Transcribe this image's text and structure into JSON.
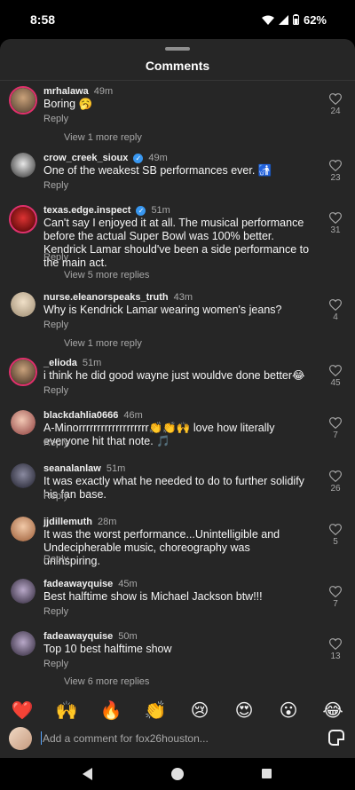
{
  "status": {
    "time": "8:58",
    "battery": "62%"
  },
  "sheet": {
    "title": "Comments"
  },
  "comments": [
    {
      "user": "mrhalawa",
      "time": "49m",
      "verified": false,
      "text": "Boring 🥱",
      "reply": "Reply",
      "likes": "24",
      "view_replies": "View 1 more reply"
    },
    {
      "user": "crow_creek_sioux",
      "time": "49m",
      "verified": true,
      "text": "One of the weakest SB performances ever. 🚮",
      "reply": "Reply",
      "likes": "23",
      "view_replies": ""
    },
    {
      "user": "texas.edge.inspect",
      "time": "51m",
      "verified": true,
      "text": "Can't say I enjoyed it at all. The musical performance before the actual Super Bowl was 100% better. Kendrick Lamar should've been a side performance to the main act.",
      "reply": "Reply",
      "likes": "31",
      "view_replies": "View 5 more replies"
    },
    {
      "user": "nurse.eleanorspeaks_truth",
      "time": "43m",
      "verified": false,
      "text": "Why is Kendrick Lamar wearing women's jeans?",
      "reply": "Reply",
      "likes": "4",
      "view_replies": "View 1 more reply"
    },
    {
      "user": "_elioda",
      "time": "51m",
      "verified": false,
      "text": "i think he did good wayne just wouldve done better😂",
      "reply": "Reply",
      "likes": "45",
      "view_replies": ""
    },
    {
      "user": "blackdahlia0666",
      "time": "46m",
      "verified": false,
      "text": "A-Minorrrrrrrrrrrrrrrrrrr👏👏🙌 love how literally everyone hit that note. 🎵",
      "reply": "Reply",
      "likes": "7",
      "view_replies": ""
    },
    {
      "user": "seanalanlaw",
      "time": "51m",
      "verified": false,
      "text": "It was exactly what he needed to do to further solidify his fan base.",
      "reply": "Reply",
      "likes": "26",
      "view_replies": ""
    },
    {
      "user": "jjdillemuth",
      "time": "28m",
      "verified": false,
      "text": "It was the worst performance...Unintelligible and Undecipherable music, choreography was uninspiring.",
      "reply": "Reply",
      "likes": "5",
      "view_replies": ""
    },
    {
      "user": "fadeawayquise",
      "time": "45m",
      "verified": false,
      "text": "Best halftime show is Michael Jackson btw!!!",
      "reply": "Reply",
      "likes": "7",
      "view_replies": ""
    },
    {
      "user": "fadeawayquise",
      "time": "50m",
      "verified": false,
      "text": "Top 10 best halftime show",
      "reply": "Reply",
      "likes": "13",
      "view_replies": "View 6 more replies"
    }
  ],
  "emoji_bar": [
    "❤️",
    "🙌",
    "🔥",
    "👏",
    "😢",
    "😍",
    "😮",
    "😂"
  ],
  "comment_input": {
    "placeholder": "Add a comment for fox26houston..."
  }
}
